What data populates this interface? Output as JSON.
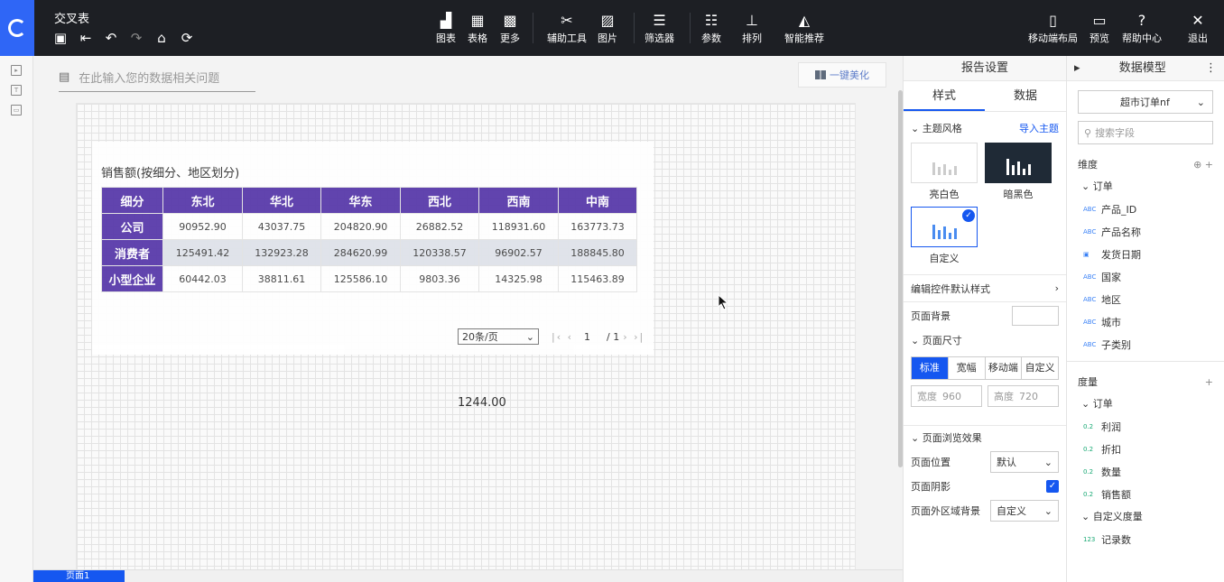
{
  "topbar": {
    "title": "交叉表",
    "tools": [
      {
        "label": "图表",
        "icon": "bar-chart-icon"
      },
      {
        "label": "表格",
        "icon": "table-icon"
      },
      {
        "label": "更多",
        "icon": "grid-icon"
      },
      {
        "label": "辅助工具",
        "icon": "tools-icon"
      },
      {
        "label": "图片",
        "icon": "image-icon"
      },
      {
        "label": "筛选器",
        "icon": "filter-icon"
      },
      {
        "label": "参数",
        "icon": "params-icon"
      },
      {
        "label": "排列",
        "icon": "arrange-icon"
      },
      {
        "label": "智能推荐",
        "icon": "recommend-icon"
      }
    ],
    "right_tools": [
      {
        "label": "移动端布局",
        "icon": "mobile-icon"
      },
      {
        "label": "预览",
        "icon": "preview-icon"
      },
      {
        "label": "帮助中心",
        "icon": "help-icon"
      },
      {
        "label": "退出",
        "icon": "close-icon"
      }
    ]
  },
  "canvas": {
    "ask_placeholder": "在此输入您的数据相关问题",
    "beautify_label": "一键美化",
    "widget_title": "销售额(按细分、地区划分)",
    "table": {
      "corner": "细分",
      "columns": [
        "东北",
        "华北",
        "华东",
        "西北",
        "西南",
        "中南"
      ],
      "rows": [
        {
          "label": "公司",
          "values": [
            "90952.90",
            "43037.75",
            "204820.90",
            "26882.52",
            "118931.60",
            "163773.73"
          ]
        },
        {
          "label": "消费者",
          "values": [
            "125491.42",
            "132923.28",
            "284620.99",
            "120338.57",
            "96902.57",
            "188845.80"
          ]
        },
        {
          "label": "小型企业",
          "values": [
            "60442.03",
            "38811.61",
            "125586.10",
            "9803.36",
            "14325.98",
            "115463.89"
          ]
        }
      ]
    },
    "pager": {
      "page_size": "20条/页",
      "current": "1",
      "total": "/ 1"
    },
    "kpi_value": "1244.00",
    "page_tab": "页面1"
  },
  "settings": {
    "header": "报告设置",
    "tab_style": "样式",
    "tab_data": "数据",
    "theme_section": "主题风格",
    "import_theme": "导入主题",
    "theme_light": "亮白色",
    "theme_dark": "暗黑色",
    "theme_custom": "自定义",
    "edit_widget_style": "编辑控件默认样式",
    "page_background": "页面背景",
    "page_size_section": "页面尺寸",
    "size_options": [
      "标准",
      "宽幅",
      "移动端",
      "自定义"
    ],
    "width_label": "宽度",
    "width_value": "960",
    "height_label": "高度",
    "height_value": "720",
    "browse_section": "页面浏览效果",
    "page_position": "页面位置",
    "page_position_value": "默认",
    "page_shadow": "页面阴影",
    "outside_bg": "页面外区域背景",
    "outside_bg_value": "自定义"
  },
  "model": {
    "header": "数据模型",
    "dataset": "超市订单nf",
    "search_placeholder": "搜索字段",
    "dimension_label": "维度",
    "dimension_group": "订单",
    "dimensions": [
      {
        "type": "ABC",
        "name": "产品_ID"
      },
      {
        "type": "ABC",
        "name": "产品名称"
      },
      {
        "type": "DATE",
        "name": "发货日期"
      },
      {
        "type": "ABC",
        "name": "国家"
      },
      {
        "type": "ABC",
        "name": "地区"
      },
      {
        "type": "ABC",
        "name": "城市"
      },
      {
        "type": "ABC",
        "name": "子类别"
      }
    ],
    "measure_label": "度量",
    "measure_group": "订单",
    "measures": [
      {
        "type": "0.2",
        "name": "利润"
      },
      {
        "type": "0.2",
        "name": "折扣"
      },
      {
        "type": "0.2",
        "name": "数量"
      },
      {
        "type": "0.2",
        "name": "销售额"
      }
    ],
    "custom_measure_group": "自定义度量",
    "custom_measures": [
      {
        "type": "123",
        "name": "记录数"
      }
    ]
  }
}
